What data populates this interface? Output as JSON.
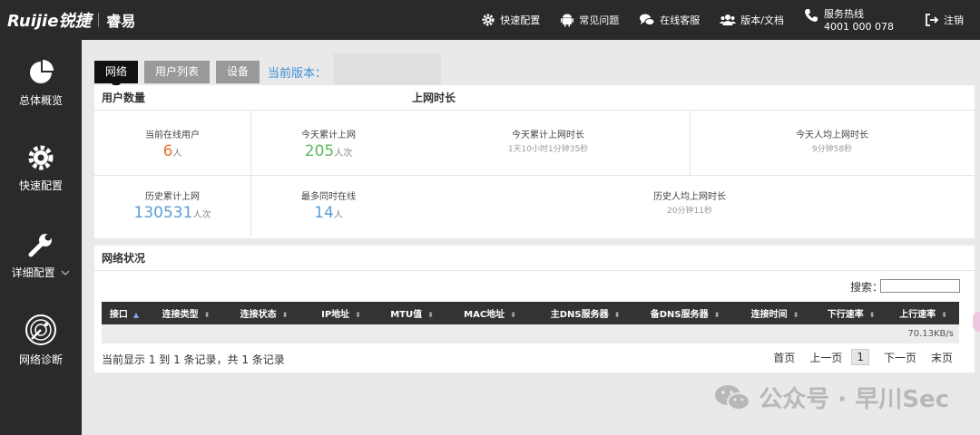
{
  "header": {
    "brand": "Ruijie锐捷",
    "sub_brand": "睿易",
    "nav": [
      {
        "label": "快速配置",
        "icon": "gear-icon"
      },
      {
        "label": "常见问题",
        "icon": "android-icon"
      },
      {
        "label": "在线客服",
        "icon": "chat-icon"
      },
      {
        "label": "版本/文档",
        "icon": "users-icon"
      }
    ],
    "hotline_label": "服务热线",
    "hotline_number": "4001 000 078",
    "logout": "注销"
  },
  "sidebar": {
    "items": [
      {
        "label": "总体概览",
        "icon": "pie-chart-icon"
      },
      {
        "label": "快速配置",
        "icon": "gear-icon"
      },
      {
        "label": "详细配置",
        "icon": "wrench-icon"
      },
      {
        "label": "网络诊断",
        "icon": "radar-icon"
      }
    ]
  },
  "tabs": [
    "网络",
    "用户列表",
    "设备"
  ],
  "current_version_label": "当前版本：",
  "stats": {
    "user_count_title": "用户数量",
    "online_time_title": "上网时长",
    "current_online_label": "当前在线用户",
    "current_online_value": "6",
    "current_online_unit": "人",
    "today_total_label": "今天累计上网",
    "today_total_value": "205",
    "today_total_unit": "人次",
    "today_duration_label": "今天累计上网时长",
    "today_duration_value": "1天10小时1分钟35秒",
    "today_avg_label": "今天人均上网时长",
    "today_avg_value": "9分钟58秒",
    "history_total_label": "历史累计上网",
    "history_total_value": "130531",
    "history_total_unit": "人次",
    "max_concurrent_label": "最多同时在线",
    "max_concurrent_value": "14",
    "max_concurrent_unit": "人",
    "history_avg_label": "历史人均上网时长",
    "history_avg_value": "20分钟11秒",
    "colors": {
      "orange": "#e8732a",
      "green": "#5cb85c",
      "blue": "#5b9bd5"
    }
  },
  "network": {
    "title": "网络状况",
    "search_label": "搜索：",
    "search_value": "",
    "columns": [
      "接口",
      "连接类型",
      "连接状态",
      "IP地址",
      "MTU值",
      "MAC地址",
      "主DNS服务器",
      "备DNS服务器",
      "连接时间",
      "下行速率",
      "上行速率"
    ],
    "row": {
      "upload_rate": "70.13KB/s"
    },
    "summary": "当前显示 1 到 1 条记录，共 1 条记录",
    "pager": {
      "first": "首页",
      "prev": "上一页",
      "current": "1",
      "next": "下一页",
      "last": "末页"
    }
  },
  "watermark": "公众号 · 早川Sec"
}
